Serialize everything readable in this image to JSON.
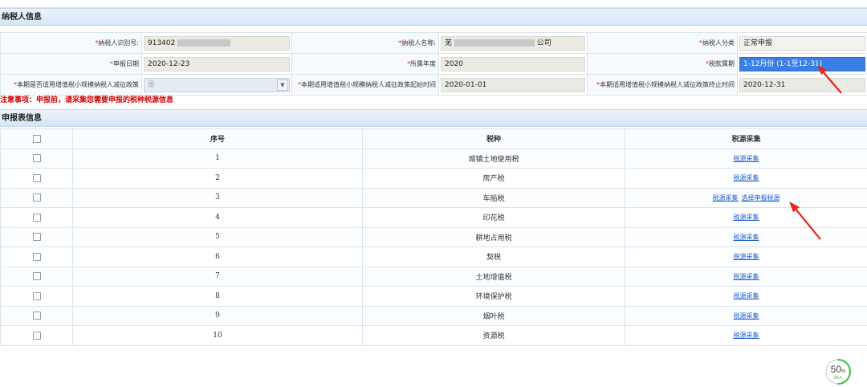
{
  "taxpayer_section": {
    "title": "纳税人信息"
  },
  "fields": {
    "taxpayer_id": {
      "label": "纳税人识别号:",
      "value": "913402"
    },
    "taxpayer_name": {
      "label": "纳税人名称:",
      "value_prefix": "芜",
      "value_suffix": "公司"
    },
    "taxpayer_category": {
      "label": "纳税人分类",
      "value": "正常申报"
    },
    "declare_date": {
      "label": "申报日期",
      "value": "2020-12-23"
    },
    "year": {
      "label": "所属年度",
      "value": "2020"
    },
    "tax_period": {
      "label": "税款属期",
      "value": "1-12月份 (1-1至12-31)"
    },
    "policy_applicable": {
      "label": "本期是否适用增值税小规模纳税人减征政策",
      "value": "是"
    },
    "policy_start": {
      "label": "本期适用增值税小规模纳税人减征政策起始时间",
      "value": "2020-01-01"
    },
    "policy_end": {
      "label": "本期适用增值税小规模纳税人减征政策终止时间",
      "value": "2020-12-31"
    }
  },
  "required_mark": "*",
  "notice": "注意事项：申报前，请采集您需要申报的税种税源信息",
  "declaration_section": {
    "title": "申报表信息"
  },
  "table": {
    "headers": {
      "index": "序号",
      "tax_type": "税种",
      "collect": "税源采集"
    },
    "rows": [
      {
        "index": "1",
        "tax_type": "城镇土地使用税",
        "collect": "税源采集"
      },
      {
        "index": "2",
        "tax_type": "房产税",
        "collect": "税源采集"
      },
      {
        "index": "3",
        "tax_type": "车船税",
        "collect": "税源采集",
        "extra": "选择申报税源"
      },
      {
        "index": "4",
        "tax_type": "印花税",
        "collect": "税源采集"
      },
      {
        "index": "5",
        "tax_type": "耕地占用税",
        "collect": "税源采集"
      },
      {
        "index": "6",
        "tax_type": "契税",
        "collect": "税源采集"
      },
      {
        "index": "7",
        "tax_type": "土地增值税",
        "collect": "税源采集"
      },
      {
        "index": "8",
        "tax_type": "环境保护税",
        "collect": "税源采集"
      },
      {
        "index": "9",
        "tax_type": "烟叶税",
        "collect": "税源采集"
      },
      {
        "index": "10",
        "tax_type": "资源税",
        "collect": "税源采集"
      }
    ]
  },
  "progress": {
    "percent": 50,
    "percent_label": "50",
    "unit": "%",
    "speed": "0K/s"
  },
  "colors": {
    "accent": "#3a7fe6",
    "link": "#1a5fd0",
    "notice": "#d40000",
    "annotation_arrow": "#e8261a"
  }
}
